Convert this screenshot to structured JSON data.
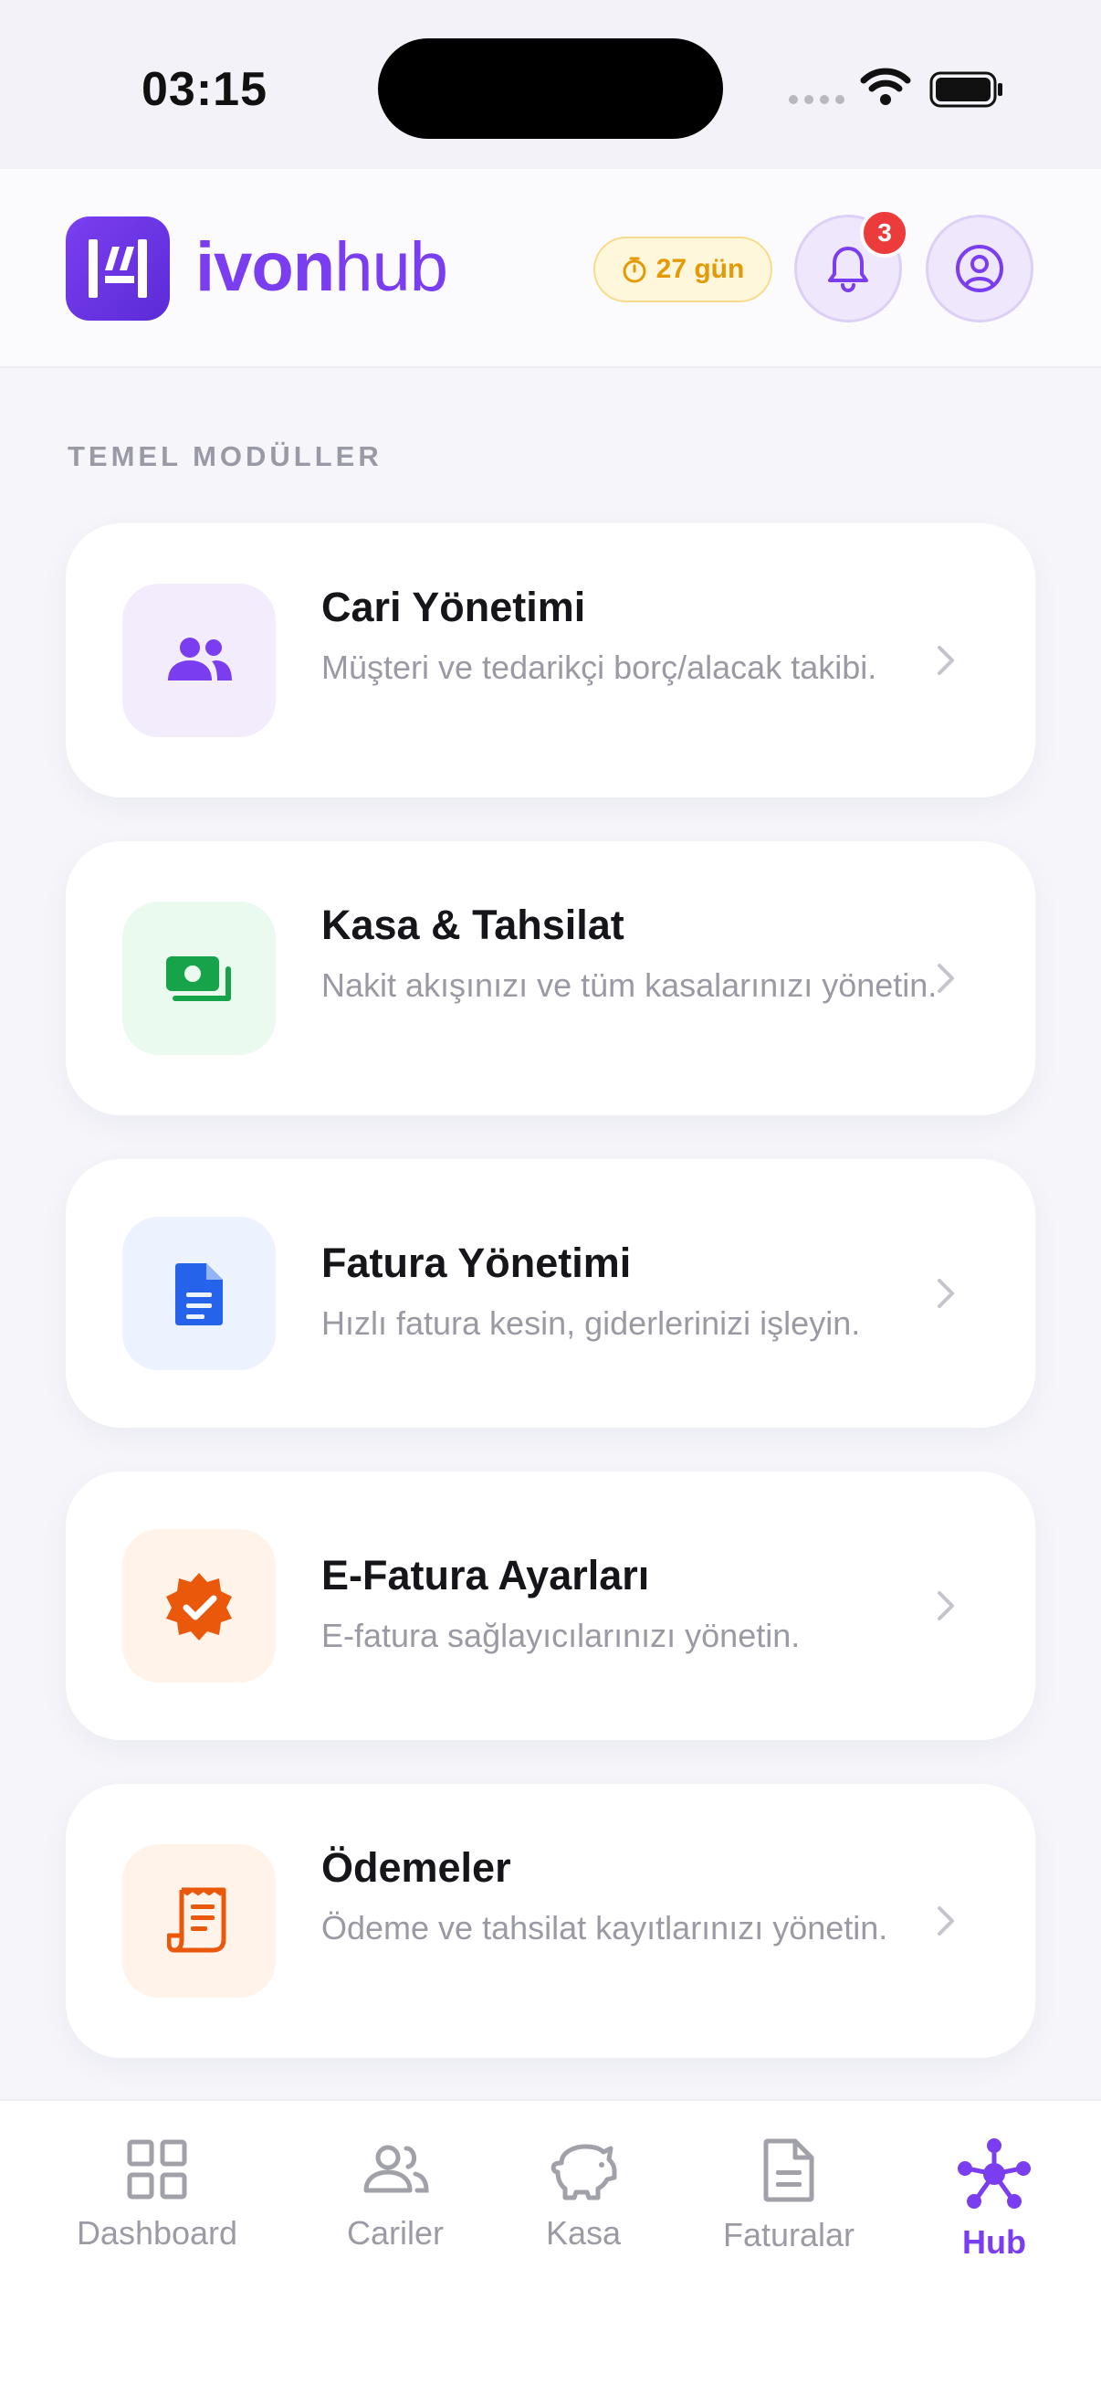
{
  "status_bar": {
    "time": "03:15"
  },
  "header": {
    "logo_bold": "ivon",
    "logo_light": "hub",
    "trial_label": "27 gün",
    "notification_count": "3"
  },
  "section": {
    "title": "TEMEL MODÜLLER"
  },
  "modules": [
    {
      "title": "Cari Yönetimi",
      "desc": "Müşteri ve tedarikçi borç/alacak takibi.",
      "icon": "users-icon",
      "icon_color": "#7a3df0",
      "icon_bg": "#f3ecfd"
    },
    {
      "title": "Kasa & Tahsilat",
      "desc": "Nakit akışınızı ve tüm kasalarınızı yönetin.",
      "icon": "cash-icon",
      "icon_color": "#16a34a",
      "icon_bg": "#ebfaef"
    },
    {
      "title": "Fatura Yönetimi",
      "desc": "Hızlı fatura kesin, giderlerinizi işleyin.",
      "icon": "document-icon",
      "icon_color": "#2563eb",
      "icon_bg": "#ecf3fe"
    },
    {
      "title": "E-Fatura Ayarları",
      "desc": "E-fatura sağlayıcılarınızı yönetin.",
      "icon": "verified-badge-icon",
      "icon_color": "#ea580c",
      "icon_bg": "#fff3ea"
    },
    {
      "title": "Ödemeler",
      "desc": "Ödeme ve tahsilat kayıtlarınızı yönetin.",
      "icon": "receipt-icon",
      "icon_color": "#ea580c",
      "icon_bg": "#fff3ea"
    }
  ],
  "nav": [
    {
      "label": "Dashboard",
      "icon": "grid-icon"
    },
    {
      "label": "Cariler",
      "icon": "users-icon"
    },
    {
      "label": "Kasa",
      "icon": "piggy-bank-icon"
    },
    {
      "label": "Faturalar",
      "icon": "document-icon"
    },
    {
      "label": "Hub",
      "icon": "hub-icon",
      "active": true
    }
  ],
  "colors": {
    "accent": "#7a3df0",
    "badge": "#ec3b3b",
    "trial": "#e39a06"
  }
}
